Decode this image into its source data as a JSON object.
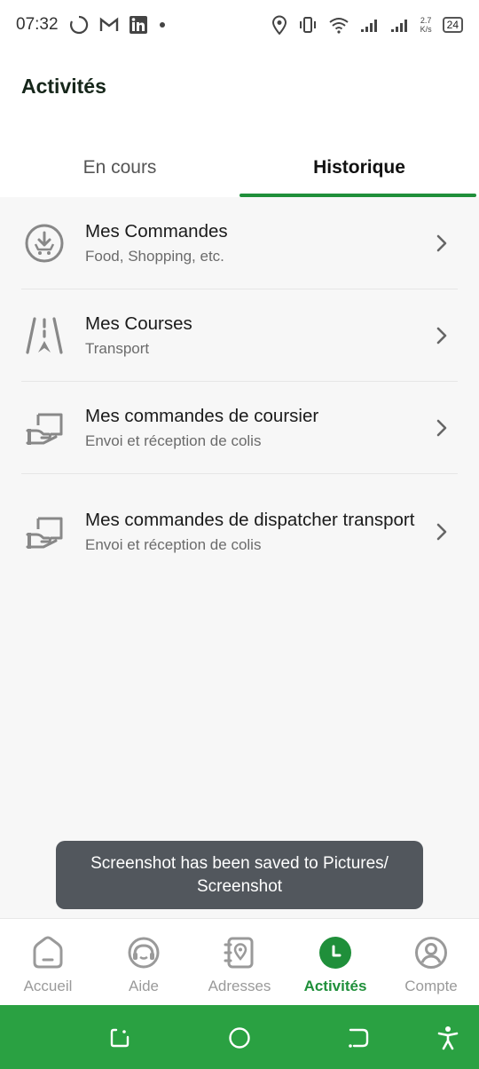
{
  "status_bar": {
    "time": "07:32",
    "speed_value": "2.7",
    "speed_unit": "K/s",
    "battery": "24",
    "icons": [
      "loading-circle-icon",
      "gmail-icon",
      "linkedin-icon",
      "dot-icon",
      "location-icon",
      "vibrate-icon",
      "wifi-icon",
      "signal-icon",
      "signal-icon",
      "battery-icon"
    ]
  },
  "header": {
    "title": "Activités"
  },
  "tabs": [
    {
      "label": "En cours",
      "active": false
    },
    {
      "label": "Historique",
      "active": true
    }
  ],
  "items": [
    {
      "title": "Mes Commandes",
      "subtitle": "Food, Shopping, etc.",
      "icon": "cart-download-icon"
    },
    {
      "title": "Mes Courses",
      "subtitle": "Transport",
      "icon": "road-icon"
    },
    {
      "title": "Mes commandes de coursier",
      "subtitle": "Envoi et réception de colis",
      "icon": "hand-package-icon"
    },
    {
      "title": "Mes commandes de dispatcher transport",
      "subtitle": "Envoi et réception de colis",
      "icon": "hand-package-icon"
    }
  ],
  "toast": {
    "message": "Screenshot has been saved to  Pictures/ Screenshot"
  },
  "bottom_nav": [
    {
      "label": "Accueil",
      "icon": "home-icon",
      "active": false
    },
    {
      "label": "Aide",
      "icon": "help-chat-icon",
      "active": false
    },
    {
      "label": "Adresses",
      "icon": "address-book-icon",
      "active": false
    },
    {
      "label": "Activités",
      "icon": "clock-icon",
      "active": true
    },
    {
      "label": "Compte",
      "icon": "account-icon",
      "active": false
    }
  ],
  "colors": {
    "accent": "#1f8f3a",
    "system_nav": "#2aa142",
    "toast_bg": "#52575d"
  }
}
